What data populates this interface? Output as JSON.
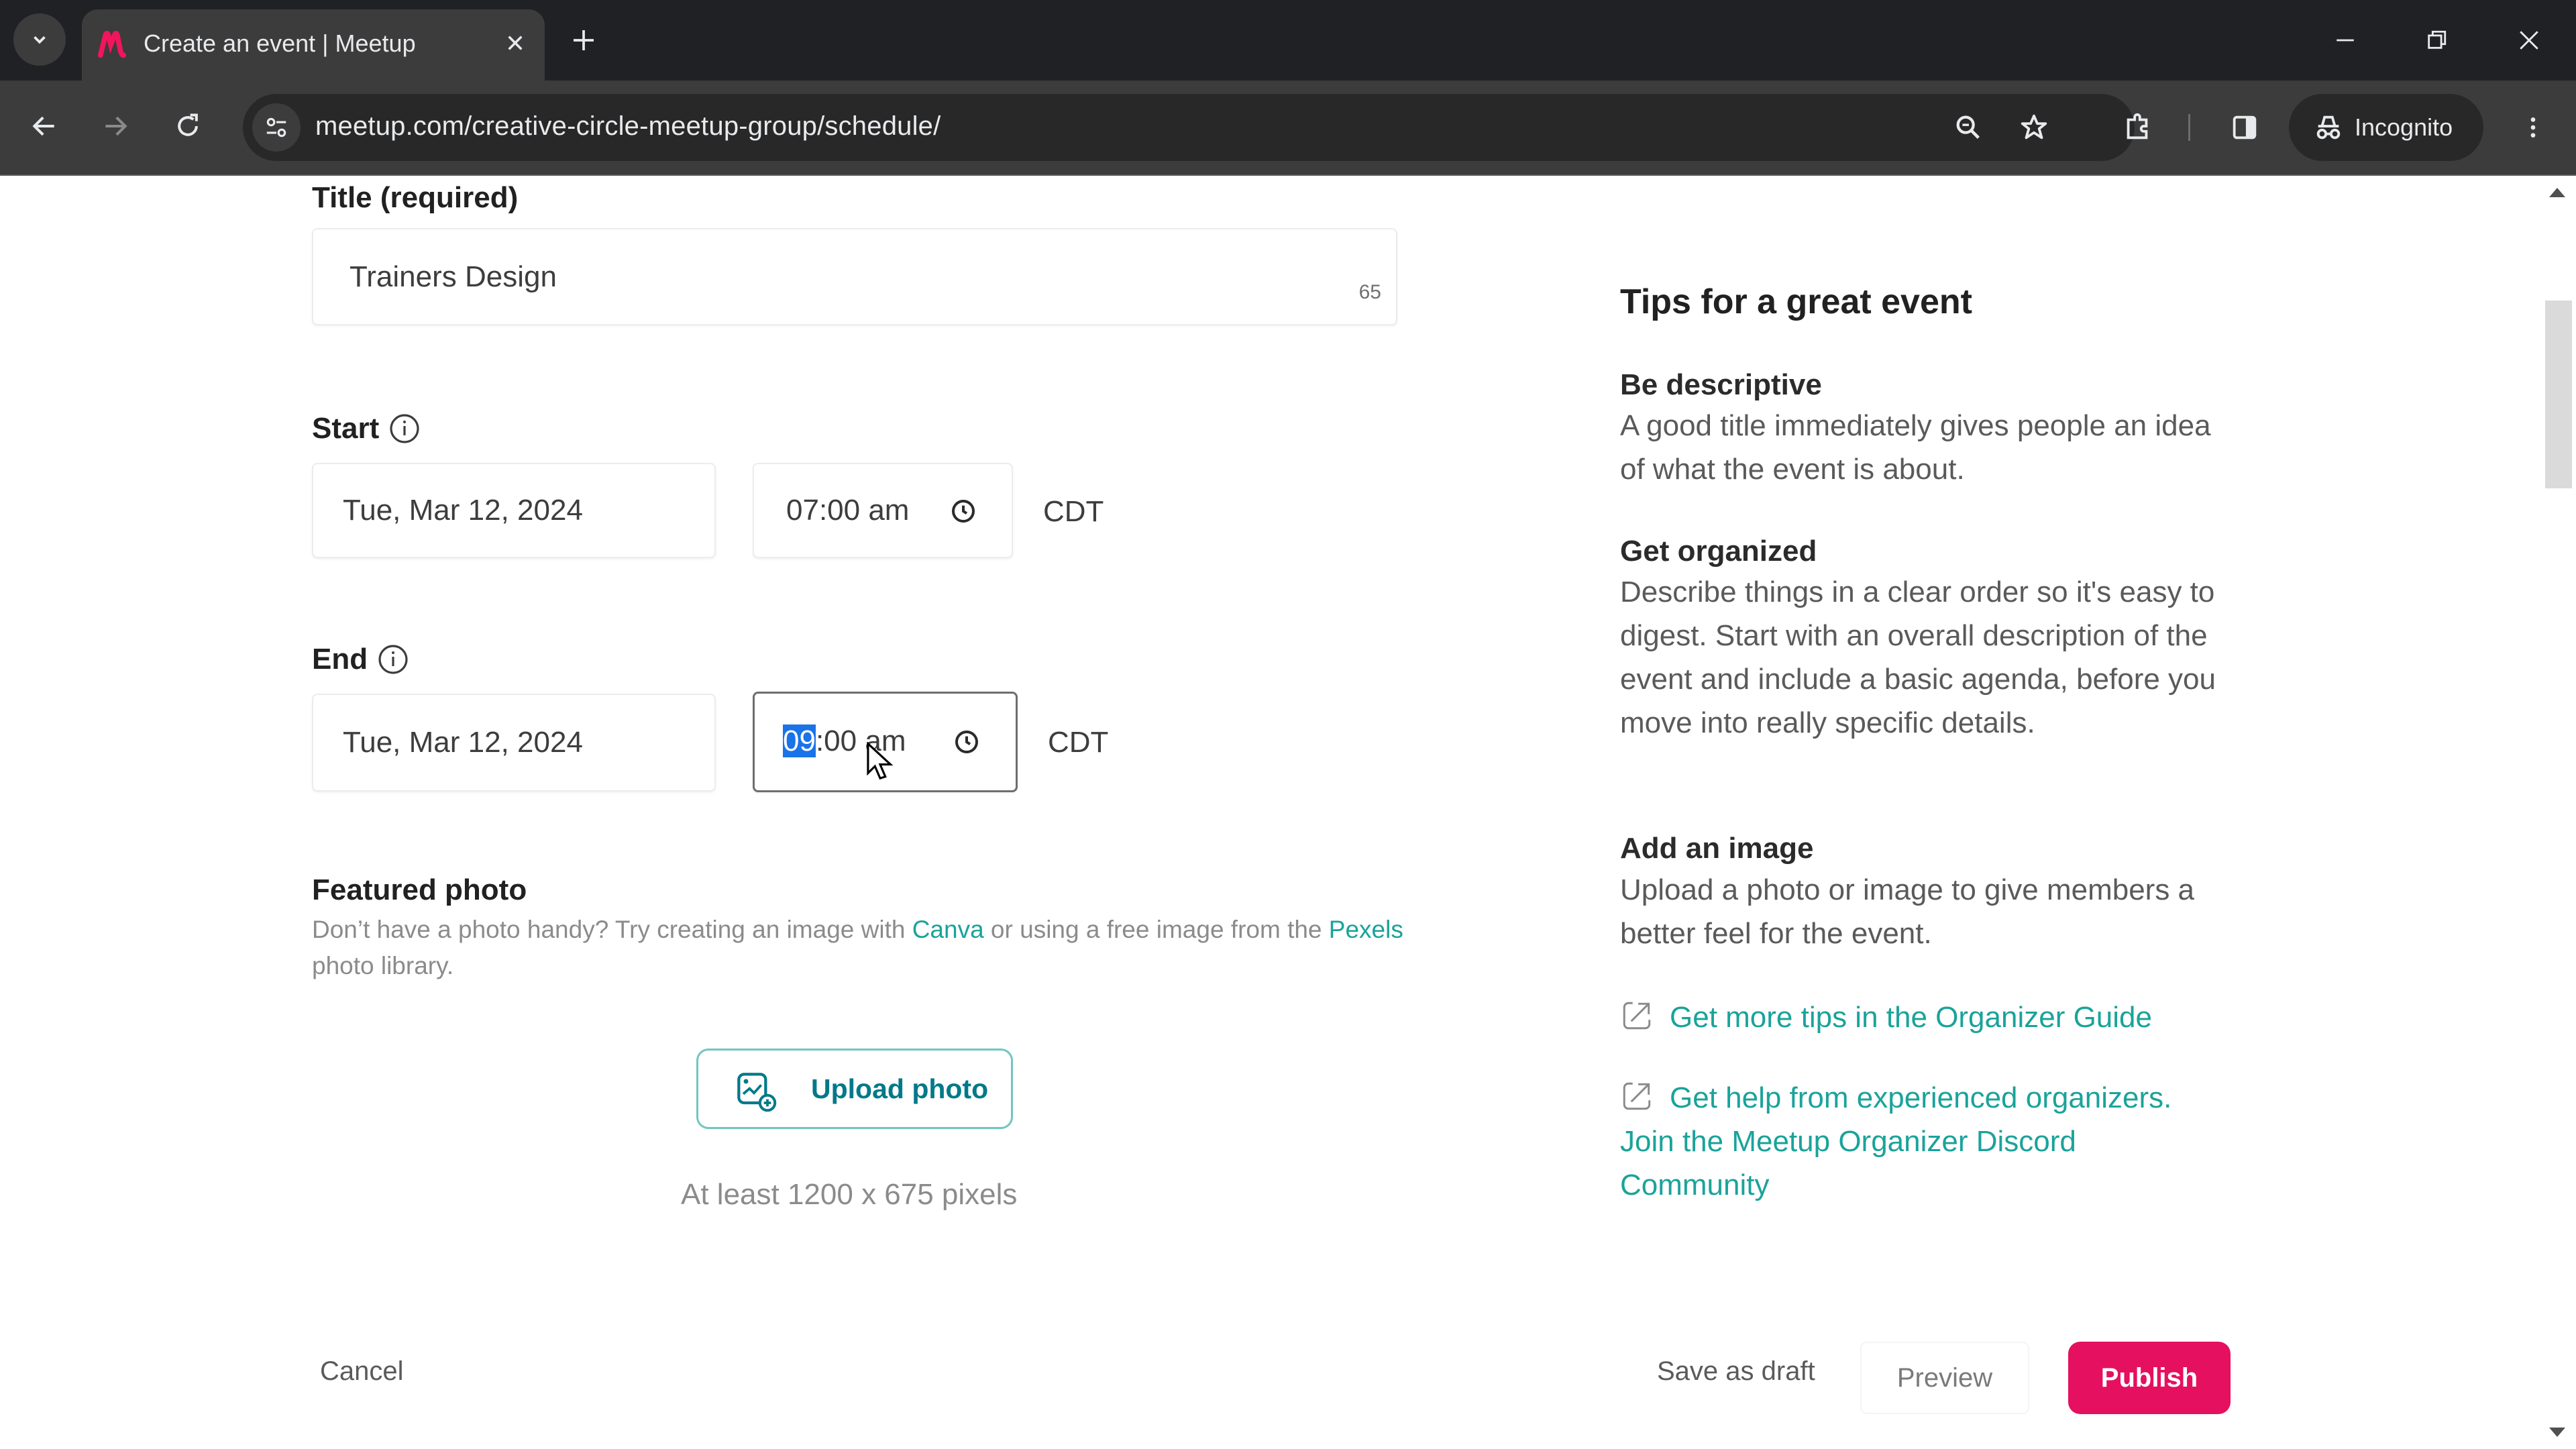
{
  "browser": {
    "tab_title": "Create an event | Meetup",
    "url": "meetup.com/creative-circle-meetup-group/schedule/",
    "incognito_label": "Incognito",
    "brand_color": "#f65858"
  },
  "form": {
    "title_label": "Title (required)",
    "title_value": "Trainers Design",
    "title_chars_left": "65",
    "start_label": "Start",
    "start_date": "Tue, Mar 12, 2024",
    "start_time": "07:00 am",
    "start_tz": "CDT",
    "end_label": "End",
    "end_date": "Tue, Mar 12, 2024",
    "end_time_hour": "09",
    "end_time_rest": ":00 am",
    "end_tz": "CDT",
    "featured_photo_title": "Featured photo",
    "featured_photo_desc_1": "Don’t have a photo handy? Try creating an image with ",
    "canva_link": "Canva",
    "featured_photo_desc_2": " or using a free image from the ",
    "pexels_link": "Pexels",
    "featured_photo_desc_3": " photo library.",
    "upload_button": "Upload photo",
    "upload_hint": "At least 1200 x 675 pixels"
  },
  "tips": {
    "title": "Tips for a great event",
    "items": [
      {
        "heading": "Be descriptive",
        "body": "A good title immediately gives people an idea of what the event is about."
      },
      {
        "heading": "Get organized",
        "body": "Describe things in a clear order so it's easy to digest. Start with an overall description of the event and include a basic agenda, before you move into really specific details."
      },
      {
        "heading": "Add an image",
        "body": "Upload a photo or image to give members a better feel for the event."
      }
    ],
    "links": [
      "Get more tips in the Organizer Guide",
      "Get help from experienced organizers. Join the Meetup Organizer Discord Community"
    ]
  },
  "footer": {
    "cancel": "Cancel",
    "save_draft": "Save as draft",
    "preview": "Preview",
    "publish": "Publish",
    "publish_color": "#e5105f"
  }
}
